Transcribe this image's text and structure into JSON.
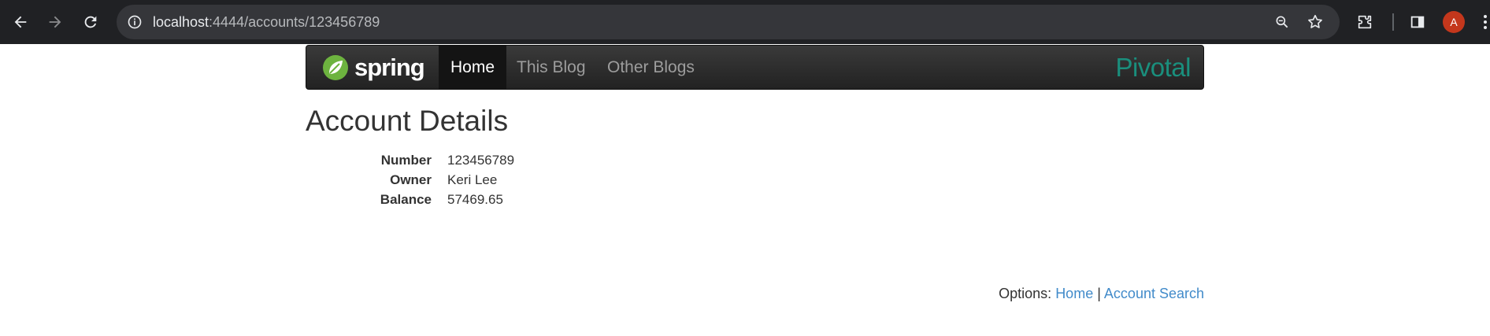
{
  "browser": {
    "url_host": "localhost",
    "url_path": ":4444/accounts/123456789",
    "avatar_letter": "A",
    "icons": [
      "back-icon",
      "forward-icon",
      "reload-icon",
      "site-info-icon",
      "zoom-icon",
      "bookmark-star-icon",
      "extensions-icon",
      "side-panel-icon",
      "menu-dots-icon"
    ]
  },
  "navbar": {
    "brand": "spring",
    "items": [
      {
        "label": "Home",
        "active": true
      },
      {
        "label": "This Blog",
        "active": false
      },
      {
        "label": "Other Blogs",
        "active": false
      }
    ],
    "partner_logo": "Pivotal",
    "brand_color": "#6db33f",
    "partner_color": "#1a8f7d"
  },
  "page": {
    "title": "Account Details",
    "details": [
      {
        "label": "Number",
        "value": "123456789"
      },
      {
        "label": "Owner",
        "value": "Keri Lee"
      },
      {
        "label": "Balance",
        "value": "57469.65"
      }
    ]
  },
  "footer": {
    "options_label": "Options:",
    "links": [
      "Home",
      "Account Search"
    ],
    "separator": "|",
    "link_color": "#428bca"
  }
}
